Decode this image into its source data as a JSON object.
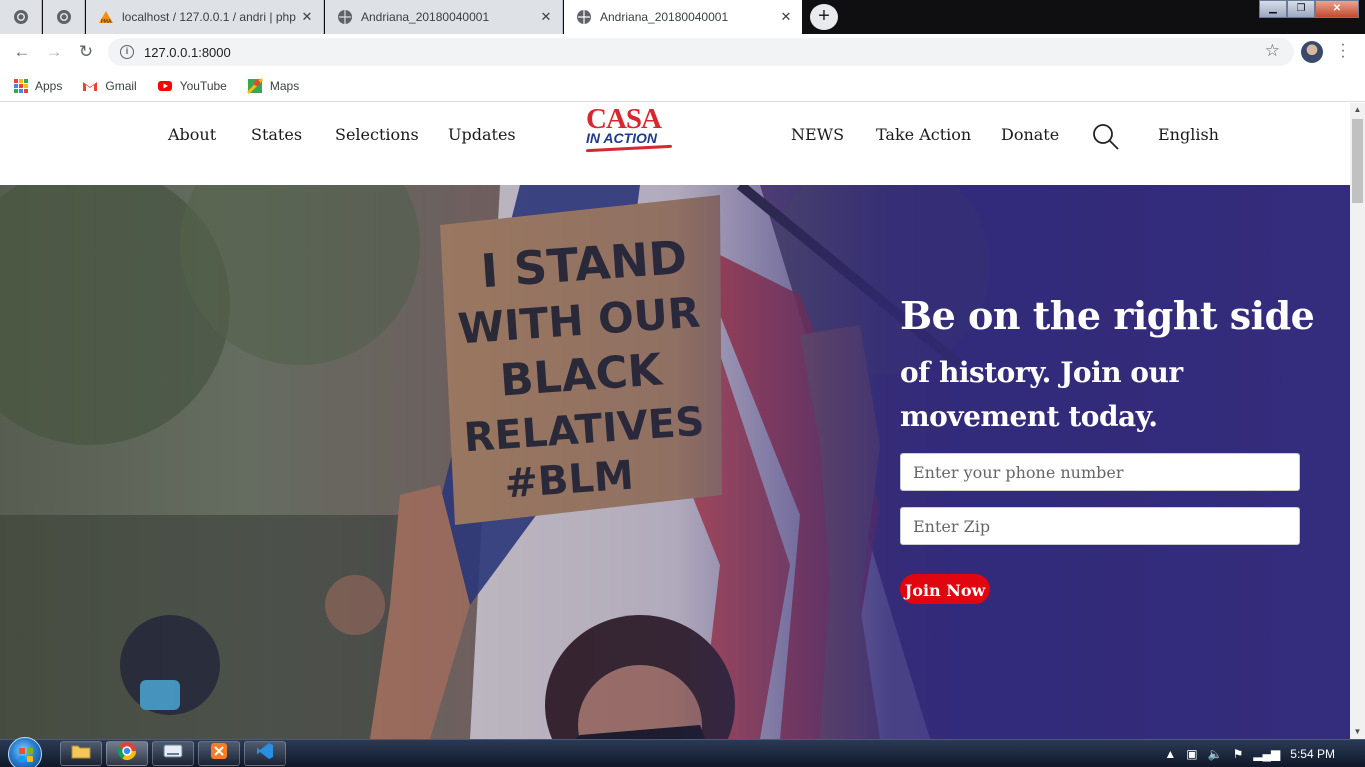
{
  "browser": {
    "tabs": [
      {
        "title": "localhost / 127.0.0.1 / andri | php",
        "favicon": "phpmyadmin-icon"
      },
      {
        "title": "Andriana_20180040001",
        "favicon": "globe-icon"
      },
      {
        "title": "Andriana_20180040001",
        "favicon": "globe-icon",
        "active": true
      }
    ],
    "url": "127.0.0.1:8000",
    "bookmarks": [
      {
        "label": "Apps",
        "icon": "apps-grid-icon"
      },
      {
        "label": "Gmail",
        "icon": "gmail-icon"
      },
      {
        "label": "YouTube",
        "icon": "youtube-icon"
      },
      {
        "label": "Maps",
        "icon": "maps-icon"
      }
    ]
  },
  "site": {
    "nav_left": [
      "About",
      "States",
      "Selections",
      "Updates"
    ],
    "logo": {
      "line1": "CASA",
      "line2": "IN ACTION"
    },
    "nav_right": [
      "NEWS",
      "Take Action",
      "Donate"
    ],
    "language": "English"
  },
  "hero": {
    "title_line1": "Be on the right side",
    "title_line2": "of history. Join our movement today.",
    "phone_placeholder": "Enter your phone number",
    "zip_placeholder": "Enter Zip",
    "join_label": "Join Now",
    "photo_sign_text": "I STAND WITH OUR BLACK RELATIVES #BLM"
  },
  "taskbar": {
    "clock": "5:54 PM"
  },
  "colors": {
    "brand_red": "#d7282f",
    "brand_blue": "#1e3a8a",
    "hero_purple": "#342f7a",
    "join_button": "#e0050f"
  }
}
